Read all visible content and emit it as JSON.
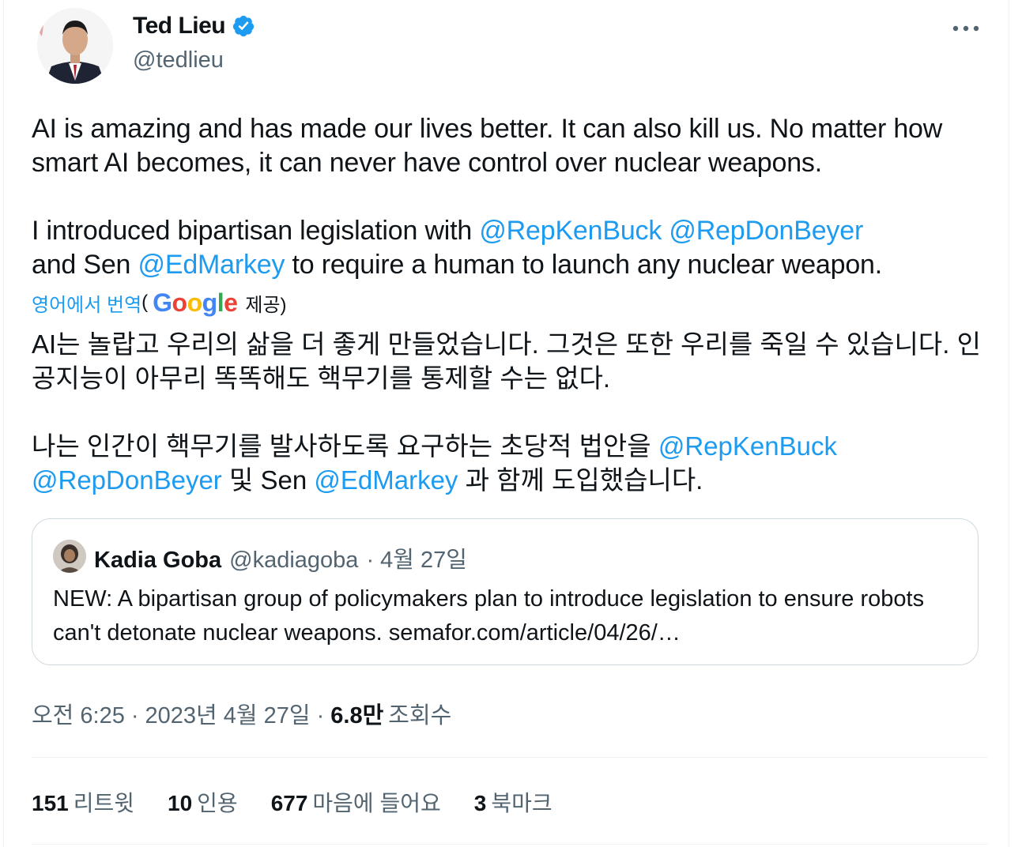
{
  "author": {
    "name": "Ted Lieu",
    "handle": "@tedlieu",
    "verified_color": "#1d9bf0"
  },
  "tweet": {
    "para1": "AI is amazing and has made our lives better. It can also kill us. No matter how smart AI becomes, it can never have control over nuclear weapons.",
    "para2_prefix": "I introduced bipartisan legislation with ",
    "mention1": "@RepKenBuck",
    "mention2": "@RepDonBeyer",
    "para2_mid": "and Sen ",
    "mention3": "@EdMarkey",
    "para2_suffix": " to require a human to launch any nuclear weapon."
  },
  "translation": {
    "label": "영어에서 번역",
    "open_paren": "(",
    "provider": "Google",
    "provided": "제공)",
    "para1": "AI는 놀랍고 우리의 삶을 더 좋게 만들었습니다. 그것은 또한 우리를 죽일 수 있습니다. 인공지능이 아무리 똑똑해도 핵무기를 통제할 수는 없다.",
    "para2_prefix": "나는 인간이 핵무기를 발사하도록 요구하는 초당적 법안을 ",
    "mention1": "@RepKenBuck",
    "mention2": "@RepDonBeyer",
    "mid": " 및 Sen ",
    "mention3": "@EdMarkey",
    "suffix": " 과 함께 도입했습니다."
  },
  "quote": {
    "name": "Kadia Goba",
    "handle": "@kadiagoba",
    "date": "· 4월 27일",
    "text": "NEW: A bipartisan group of policymakers plan to introduce legislation to ensure robots can't detonate nuclear weapons. semafor.com/article/04/26/…"
  },
  "meta": {
    "time": "오전 6:25",
    "date": "2023년 4월 27일",
    "dot": "·",
    "views_num": "6.8만",
    "views_label": "조회수"
  },
  "stats": [
    {
      "num": "151",
      "label": "리트윗"
    },
    {
      "num": "10",
      "label": "인용"
    },
    {
      "num": "677",
      "label": "마음에 들어요"
    },
    {
      "num": "3",
      "label": "북마크"
    }
  ],
  "colors": {
    "mention": "#1d9bf0",
    "secondary_text": "#536471",
    "border": "#cfd9de"
  }
}
